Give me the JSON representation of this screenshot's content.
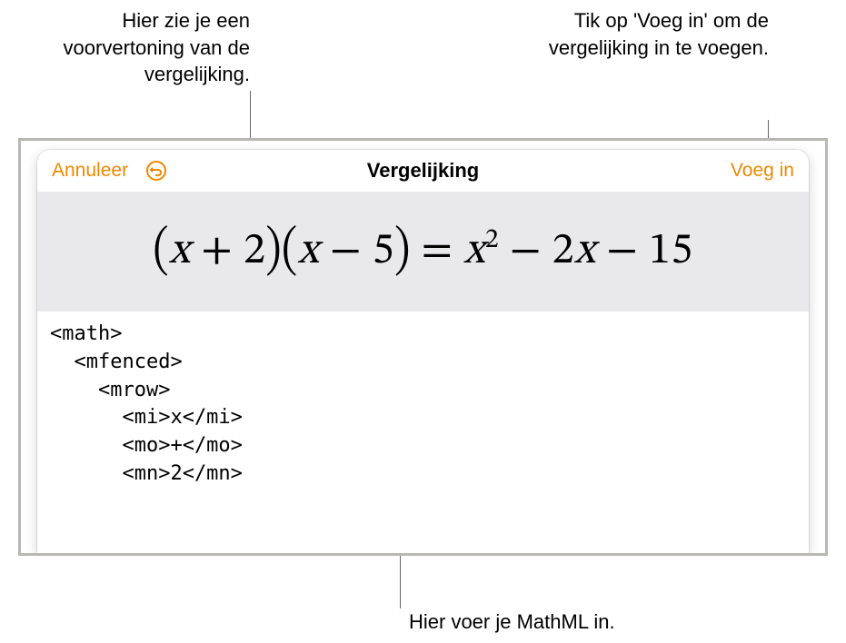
{
  "callouts": {
    "preview": "Hier zie je een voorvertoning van de vergelijking.",
    "insert": "Tik op 'Voeg in' om de vergelijking in te voegen.",
    "mathml": "Hier voer je MathML in."
  },
  "dialog": {
    "cancel_label": "Annuleer",
    "title": "Vergelijking",
    "insert_label": "Voeg in",
    "undo_icon_name": "undo-icon"
  },
  "equation": {
    "display_rendered": "(x + 2)(x − 5) = x² − 2x − 15",
    "mathml_source": "<math>\n  <mfenced>\n    <mrow>\n      <mi>x</mi>\n      <mo>+</mo>\n      <mn>2</mn>"
  },
  "colors": {
    "accent": "#ee8800"
  }
}
